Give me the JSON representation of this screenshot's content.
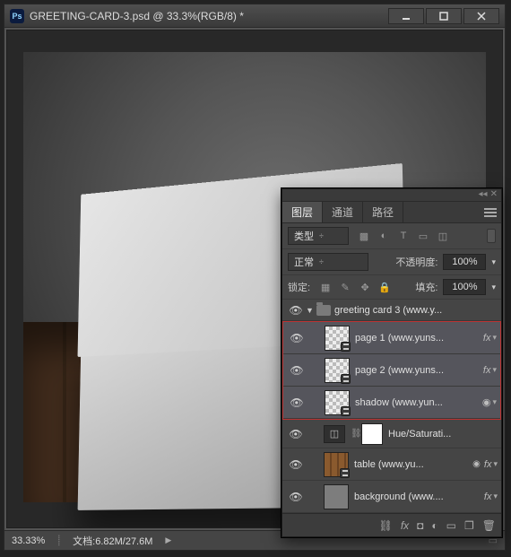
{
  "window": {
    "title": "GREETING-CARD-3.psd @ 33.3%(RGB/8) *"
  },
  "statusbar": {
    "zoom": "33.33%",
    "doc_label": "文档",
    "doc_size": ":6.82M/27.6M"
  },
  "layers_panel": {
    "tabs": {
      "layers": "图层",
      "channels": "通道",
      "paths": "路径"
    },
    "filter_label": "类型",
    "blend_mode": "正常",
    "opacity_label": "不透明度:",
    "opacity_value": "100%",
    "lock_label": "锁定:",
    "fill_label": "填充:",
    "fill_value": "100%",
    "group_name": "greeting card 3  (www.y...",
    "layers": [
      {
        "name": "page 1 (www.yuns...",
        "fx": "fx"
      },
      {
        "name": "page 2 (www.yuns...",
        "fx": "fx"
      },
      {
        "name": "shadow (www.yun...",
        "fx": ""
      }
    ],
    "adjustment": {
      "name": "Hue/Saturati..."
    },
    "table_layer": {
      "name": "table (www.yu...",
      "fx": "fx"
    },
    "background_layer": {
      "name": "background (www....",
      "fx": "fx"
    }
  }
}
